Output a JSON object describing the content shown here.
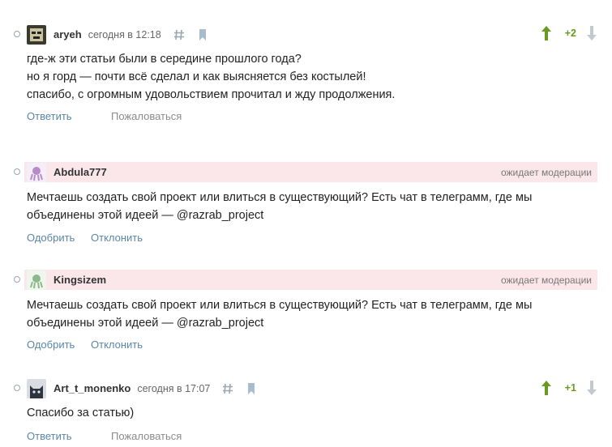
{
  "colors": {
    "upvote": "#6a9a1f",
    "downvote": "#c2c9cf",
    "link": "#5a86a8",
    "moderation_bg": "#fbe7ea"
  },
  "comments": [
    {
      "author": "aryeh",
      "time": "сегодня в 12:18",
      "score": "+2",
      "lines": [
        "где-ж эти статьи были в середине прошлого года?",
        "но я горд — почти всё сделал и как выясняется без костылей!",
        "спасибо, с огромным удовольствием прочитал и жду продолжения."
      ],
      "actions": [
        "Ответить",
        "Пожаловаться"
      ],
      "icons": [
        "hash-icon",
        "bookmark-icon",
        "upvote-arrow-icon",
        "downvote-arrow-icon"
      ]
    },
    {
      "author": "Abdula777",
      "status": "ожидает модерации",
      "lines": [
        "Мечтаешь создать свой проект или влиться в существующий? Есть чат в телеграмм, где мы",
        "объединены этой идеей — @razrab_project"
      ],
      "actions": [
        "Одобрить",
        "Отклонить"
      ]
    },
    {
      "author": "Kingsizem",
      "status": "ожидает модерации",
      "lines": [
        "Мечтаешь создать свой проект или влиться в существующий? Есть чат в телеграмм, где мы",
        "объединены этой идеей — @razrab_project"
      ],
      "actions": [
        "Одобрить",
        "Отклонить"
      ]
    },
    {
      "author": "Art_t_monenko",
      "time": "сегодня в 17:07",
      "score": "+1",
      "lines": [
        "Спасибо за статью)"
      ],
      "actions": [
        "Ответить",
        "Пожаловаться"
      ]
    }
  ]
}
